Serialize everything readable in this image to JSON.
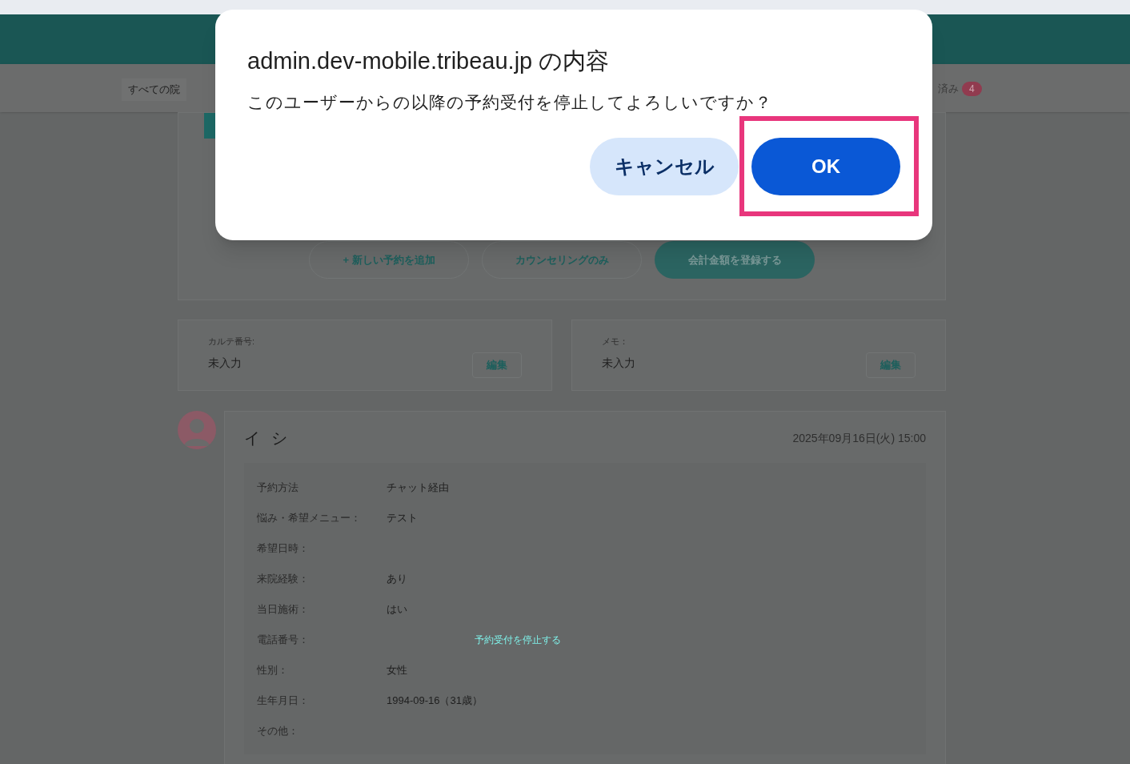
{
  "nav": {
    "clinic_filter": "すべての院",
    "status_tab": {
      "label": "済み",
      "count": "4"
    }
  },
  "actions": [
    {
      "label": "+ 新しい予約を追加",
      "kind": "outline"
    },
    {
      "label": "カウンセリングのみ",
      "kind": "outline"
    },
    {
      "label": "会計金額を登録する",
      "kind": "filled"
    }
  ],
  "info_cards": [
    {
      "label": "カルテ番号:",
      "value": "未入力",
      "button": "編集"
    },
    {
      "label": "メモ：",
      "value": "未入力",
      "button": "編集"
    }
  ],
  "reservation": {
    "name": "イ シ",
    "datetime": "2025年09月16日(火) 15:00",
    "fields": [
      {
        "label": "予約方法",
        "value": "チャット経由"
      },
      {
        "label": "悩み・希望メニュー：",
        "value": "テスト"
      },
      {
        "label": "希望日時："
      },
      {
        "label": "来院経験：",
        "value": "あり"
      },
      {
        "label": "当日施術：",
        "value": "はい"
      },
      {
        "label": "電話番号：",
        "link": "予約受付を停止する"
      },
      {
        "label": "性別：",
        "value": "女性"
      },
      {
        "label": "生年月日：",
        "value": "1994-09-16（31歳）"
      },
      {
        "label": "その他："
      }
    ]
  },
  "dialog": {
    "title": "admin.dev-mobile.tribeau.jp の内容",
    "message": "このユーザーからの以降の予約受付を停止してよろしいですか？",
    "buttons": [
      {
        "label": "キャンセル",
        "kind": "secondary"
      },
      {
        "label": "OK",
        "kind": "primary",
        "highlighted": true
      }
    ]
  }
}
